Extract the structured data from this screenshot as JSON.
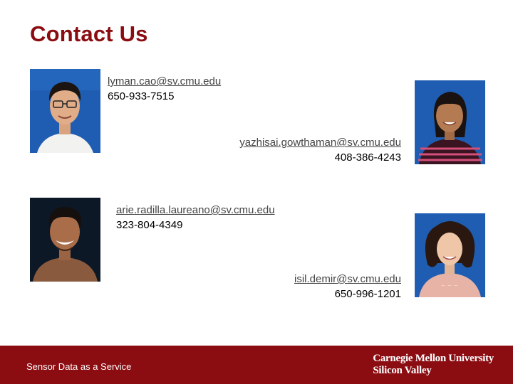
{
  "slide": {
    "title": "Contact Us"
  },
  "contacts": [
    {
      "email": "lyman.cao@sv.cmu.edu",
      "phone": "650-933-7515"
    },
    {
      "email": "yazhisai.gowthaman@sv.cmu.edu",
      "phone": "408-386-4243"
    },
    {
      "email": "arie.radilla.laureano@sv.cmu.edu",
      "phone": "323-804-4349"
    },
    {
      "email": "isil.demir@sv.cmu.edu",
      "phone": "650-996-1201"
    }
  ],
  "footer": {
    "label": "Sensor Data as a Service",
    "brand_line1": "Carnegie Mellon University",
    "brand_line2": "Silicon Valley"
  },
  "colors": {
    "brand_red": "#8b0d12",
    "photo_bg_blue": "#1e5fb4"
  }
}
